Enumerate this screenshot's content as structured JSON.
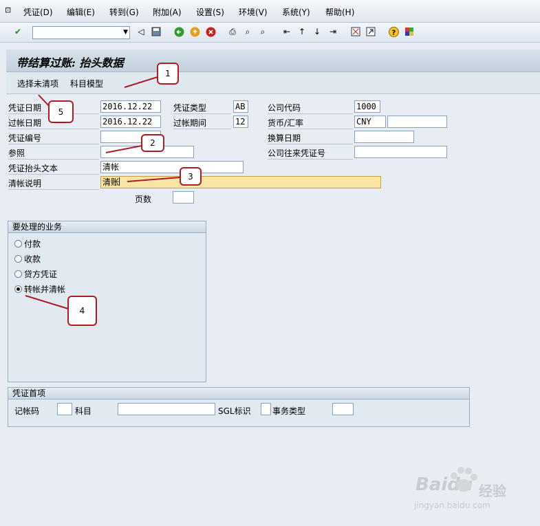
{
  "menu": [
    "凭证(D)",
    "编辑(E)",
    "转到(G)",
    "附加(A)",
    "设置(S)",
    "环境(V)",
    "系统(Y)",
    "帮助(H)"
  ],
  "title": "带结算过账: 抬头数据",
  "app_buttons": {
    "select_open_items": "选择未清项",
    "account_model": "科目模型"
  },
  "labels": {
    "doc_date": "凭证日期",
    "posting_date": "过帐日期",
    "doc_number": "凭证编号",
    "reference": "参照",
    "header_text": "凭证抬头文本",
    "clearing_text": "清帐说明",
    "page_count": "页数",
    "doc_type": "凭证类型",
    "period": "过帐期间",
    "company_code": "公司代码",
    "currency_rate": "货币/汇率",
    "translation_date": "换算日期",
    "cross_cc_number": "公司往来凭证号"
  },
  "values": {
    "doc_date": "2016.12.22",
    "posting_date": "2016.12.22",
    "doc_type": "AB",
    "period": "12",
    "company_code": "1000",
    "currency": "CNY",
    "header_text": "清帐",
    "clearing_text": "清账"
  },
  "group1": {
    "title": "要处理的业务",
    "options": [
      "付款",
      "收款",
      "贷方凭证",
      "转帐并清帐"
    ],
    "selected_index": 3
  },
  "group2": {
    "title": "凭证首项",
    "posting_key": "记帐码",
    "account": "科目",
    "sgl": "SGL标识",
    "trans_type": "事务类型"
  },
  "callouts": [
    "1",
    "2",
    "3",
    "4",
    "5"
  ],
  "watermark": {
    "brand": "Baidu",
    "cn": "经验",
    "url": "jingyan.baidu.com"
  },
  "colors": {
    "callout_border": "#b01a20",
    "highlight_field": "#fbe5a4",
    "panel_bg": "#e1e9f1"
  }
}
